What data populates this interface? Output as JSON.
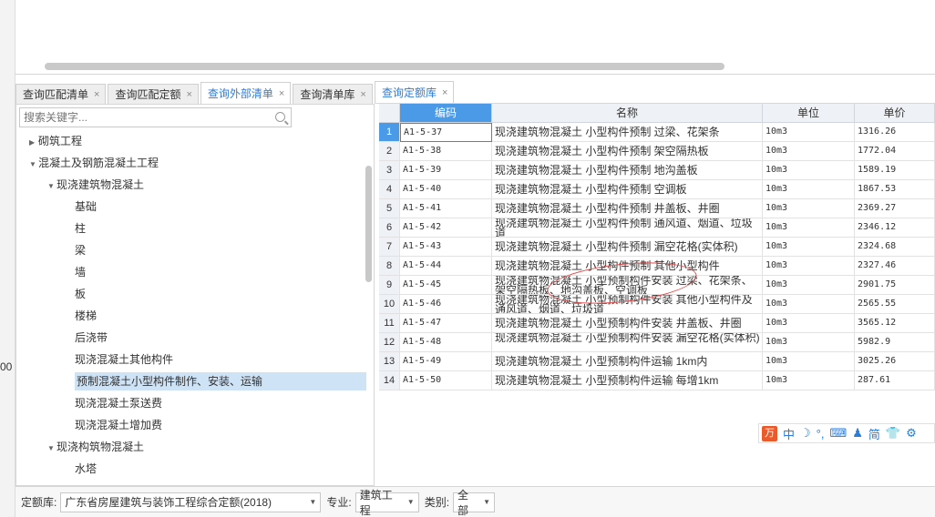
{
  "left_tabs": [
    {
      "label": "查询匹配清单",
      "active": false
    },
    {
      "label": "查询匹配定额",
      "active": false
    },
    {
      "label": "查询外部清单",
      "active": true
    },
    {
      "label": "查询清单库",
      "active": false
    }
  ],
  "right_tabs": [
    {
      "label": "查询定额库",
      "active": true
    }
  ],
  "tab_close_glyph": "×",
  "search": {
    "placeholder": "搜索关键字..."
  },
  "edge_text": "00",
  "tree": [
    {
      "label": "砌筑工程",
      "level": 0,
      "expanded": false,
      "has_children": true
    },
    {
      "label": "混凝土及钢筋混凝土工程",
      "level": 0,
      "expanded": true,
      "has_children": true
    },
    {
      "label": "现浇建筑物混凝土",
      "level": 1,
      "expanded": true,
      "has_children": true
    },
    {
      "label": "基础",
      "level": 2
    },
    {
      "label": "柱",
      "level": 2
    },
    {
      "label": "梁",
      "level": 2
    },
    {
      "label": "墙",
      "level": 2
    },
    {
      "label": "板",
      "level": 2
    },
    {
      "label": "楼梯",
      "level": 2
    },
    {
      "label": "后浇带",
      "level": 2
    },
    {
      "label": "现浇混凝土其他构件",
      "level": 2
    },
    {
      "label": "预制混凝土小型构件制作、安装、运输",
      "level": 2,
      "selected": true
    },
    {
      "label": "现浇混凝土泵送费",
      "level": 2
    },
    {
      "label": "现浇混凝土增加费",
      "level": 2
    },
    {
      "label": "现浇构筑物混凝土",
      "level": 1,
      "expanded": true,
      "has_children": true
    },
    {
      "label": "水塔",
      "level": 2
    }
  ],
  "grid": {
    "headers": {
      "code": "编码",
      "name": "名称",
      "unit": "单位",
      "price": "单价"
    },
    "rows": [
      {
        "idx": "1",
        "code": "A1-5-37",
        "name": "现浇建筑物混凝土 小型构件预制 过梁、花架条",
        "unit": "10m3",
        "price": "1316.26",
        "active": true
      },
      {
        "idx": "2",
        "code": "A1-5-38",
        "name": "现浇建筑物混凝土 小型构件预制 架空隔热板",
        "unit": "10m3",
        "price": "1772.04"
      },
      {
        "idx": "3",
        "code": "A1-5-39",
        "name": "现浇建筑物混凝土 小型构件预制 地沟盖板",
        "unit": "10m3",
        "price": "1589.19"
      },
      {
        "idx": "4",
        "code": "A1-5-40",
        "name": "现浇建筑物混凝土 小型构件预制 空调板",
        "unit": "10m3",
        "price": "1867.53"
      },
      {
        "idx": "5",
        "code": "A1-5-41",
        "name": "现浇建筑物混凝土 小型构件预制 井盖板、井圈",
        "unit": "10m3",
        "price": "2369.27"
      },
      {
        "idx": "6",
        "code": "A1-5-42",
        "name": "现浇建筑物混凝土 小型构件预制 通风道、烟道、垃圾道",
        "unit": "10m3",
        "price": "2346.12",
        "wrap": true
      },
      {
        "idx": "7",
        "code": "A1-5-43",
        "name": "现浇建筑物混凝土 小型构件预制 漏空花格(实体积)",
        "unit": "10m3",
        "price": "2324.68"
      },
      {
        "idx": "8",
        "code": "A1-5-44",
        "name": "现浇建筑物混凝土 小型构件预制 其他小型构件",
        "unit": "10m3",
        "price": "2327.46"
      },
      {
        "idx": "9",
        "code": "A1-5-45",
        "name": "现浇建筑物混凝土 小型预制构件安装 过梁、花架条、架空隔热板、地沟盖板、空调板",
        "unit": "10m3",
        "price": "2901.75",
        "wrap": true
      },
      {
        "idx": "10",
        "code": "A1-5-46",
        "name": "现浇建筑物混凝土 小型预制构件安装 其他小型构件及通风道、烟道、垃圾道",
        "unit": "10m3",
        "price": "2565.55",
        "wrap": true
      },
      {
        "idx": "11",
        "code": "A1-5-47",
        "name": "现浇建筑物混凝土 小型预制构件安装 井盖板、井圈",
        "unit": "10m3",
        "price": "3565.12"
      },
      {
        "idx": "12",
        "code": "A1-5-48",
        "name": "现浇建筑物混凝土 小型预制构件安装 漏空花格(实体积)",
        "unit": "10m3",
        "price": "5982.9",
        "wrap": true
      },
      {
        "idx": "13",
        "code": "A1-5-49",
        "name": "现浇建筑物混凝土 小型预制构件运输 1km内",
        "unit": "10m3",
        "price": "3025.26"
      },
      {
        "idx": "14",
        "code": "A1-5-50",
        "name": "现浇建筑物混凝土 小型预制构件运输 每增1km",
        "unit": "10m3",
        "price": "287.61"
      }
    ]
  },
  "ime": {
    "logo": "万",
    "items": [
      "中",
      "☽",
      "°,",
      "⌨",
      "♟",
      "简",
      "👕",
      "⚙"
    ]
  },
  "bottom": {
    "library_label": "定额库:",
    "library_value": "广东省房屋建筑与装饰工程综合定额(2018)",
    "major_label": "专业:",
    "major_value": "建筑工程",
    "category_label": "类别:",
    "category_value": "全部"
  },
  "colors": {
    "accent": "#4a9ae8",
    "selected_row": "#cfe3f7",
    "annotation": "#e05050"
  }
}
